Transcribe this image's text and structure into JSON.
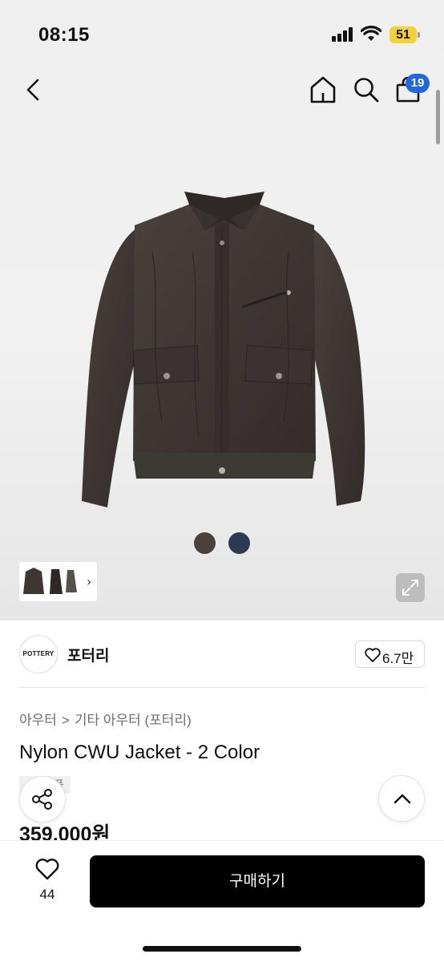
{
  "status_bar": {
    "time": "08:15",
    "battery": "51",
    "battery_color": "#f4d22f"
  },
  "nav": {
    "cart_count": "19",
    "badge_color": "#1f66e5"
  },
  "icons": {
    "back": "chevron-left-icon",
    "home": "home-icon",
    "search": "search-icon",
    "bag": "shopping-bag-icon",
    "expand": "expand-icon",
    "share": "share-icon",
    "scroll_top": "chevron-up-icon",
    "wish": "heart-icon"
  },
  "product_image": {
    "colors": [
      {
        "name": "brown",
        "hex": "#4a403c"
      },
      {
        "name": "navy",
        "hex": "#2c3a52"
      }
    ],
    "thumbnail_more_glyph": "›"
  },
  "brand": {
    "logo_text": "POTTERY",
    "name": "포터리",
    "likes": "6.7만"
  },
  "breadcrumb": {
    "category": "아우터",
    "separator": ">",
    "subcategory": "기타 아우터 (포터리)"
  },
  "product": {
    "title": "Nylon CWU Jacket - 2 Color",
    "tag": "품",
    "price": "359,000원"
  },
  "bottom_bar": {
    "wish_count": "44",
    "buy_label": "구매하기"
  }
}
